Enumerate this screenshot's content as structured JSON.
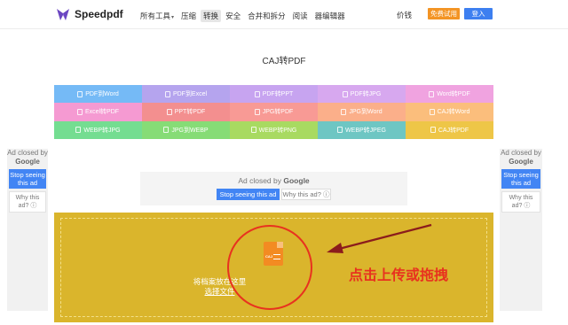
{
  "header": {
    "brand": "Speedpdf",
    "nav": [
      {
        "label": "所有工具",
        "has_caret": true,
        "active": false
      },
      {
        "label": "压缩",
        "active": false
      },
      {
        "label": "转换",
        "active": true
      },
      {
        "label": "安全",
        "active": false
      },
      {
        "label": "合并和拆分",
        "active": false
      },
      {
        "label": "阅读",
        "active": false
      },
      {
        "label": "器编辑器",
        "active": false
      }
    ],
    "caret": "▾",
    "pricing": "价钱",
    "trial_label": "免费试用",
    "login_label": "登入"
  },
  "page_title": "CAJ转PDF",
  "tools": [
    {
      "label": "PDF到Word",
      "color": "#75baf6"
    },
    {
      "label": "PDF到Excel",
      "color": "#b5a4ee"
    },
    {
      "label": "PDF转PPT",
      "color": "#c7a4f0"
    },
    {
      "label": "PDF转JPG",
      "color": "#d7a8ef"
    },
    {
      "label": "Word转PDF",
      "color": "#f0a3e0"
    },
    {
      "label": "Excel转PDF",
      "color": "#f59ad2"
    },
    {
      "label": "PPT转PDF",
      "color": "#f38f8f"
    },
    {
      "label": "JPG转PDF",
      "color": "#f89a95"
    },
    {
      "label": "JPG到Word",
      "color": "#fbaf8a"
    },
    {
      "label": "CAJ转Word",
      "color": "#fbbe7c"
    },
    {
      "label": "WEBP转JPG",
      "color": "#74dd91"
    },
    {
      "label": "JPG到WEBP",
      "color": "#86dc76"
    },
    {
      "label": "WEBP转PNG",
      "color": "#a8da61"
    },
    {
      "label": "WEBP转JPEG",
      "color": "#6ec6c3"
    },
    {
      "label": "CAJ转PDF",
      "color": "#eec647"
    }
  ],
  "ads": {
    "closed_by": "Ad closed by",
    "google": "Google",
    "stop_label": "Stop seeing this ad",
    "why_label": "Why this ad?",
    "info_glyph": "ⓘ"
  },
  "upload": {
    "drop_text": "将档案放在这里",
    "select_label": "选择文件",
    "file_type": "CAJ"
  },
  "annotation": {
    "text": "点击上传或拖拽"
  },
  "colors": {
    "upload_bg": "#dab52c",
    "annotation_red": "#e8321f",
    "accent_blue": "#3d7ff0",
    "accent_orange": "#f39424"
  }
}
